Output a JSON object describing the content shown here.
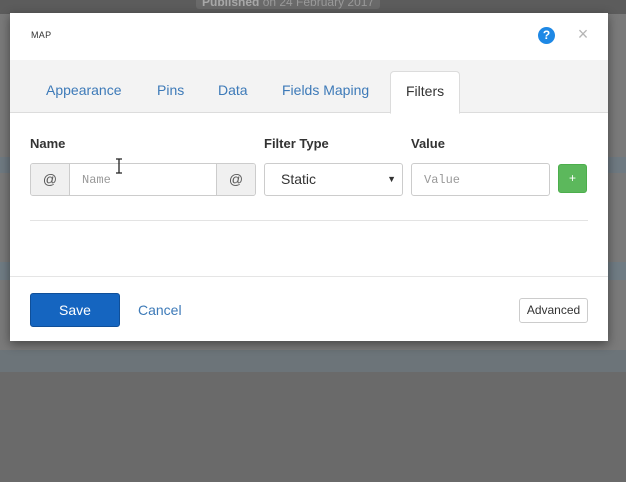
{
  "background": {
    "published_label": "Published",
    "published_date": "on 24 February 2017"
  },
  "modal": {
    "title": "MAP",
    "help_icon": "?",
    "close_icon": "×"
  },
  "tabs": [
    {
      "label": "Appearance",
      "active": false
    },
    {
      "label": "Pins",
      "active": false
    },
    {
      "label": "Data",
      "active": false
    },
    {
      "label": "Fields Maping",
      "active": false
    },
    {
      "label": "Filters",
      "active": true
    }
  ],
  "filters": {
    "headers": {
      "name": "Name",
      "filter_type": "Filter Type",
      "value": "Value"
    },
    "name_prefix": "@",
    "name_suffix": "@",
    "name_placeholder": "Name",
    "name_value": "",
    "filter_type_selected": "Static",
    "value_placeholder": "Value",
    "value_value": "",
    "add_label": "+"
  },
  "footer": {
    "save_label": "Save",
    "cancel_label": "Cancel",
    "advanced_label": "Advanced"
  },
  "colors": {
    "primary": "#1565c0",
    "link": "#3d7ab8",
    "success": "#5cb85c",
    "help": "#1e88e5"
  }
}
